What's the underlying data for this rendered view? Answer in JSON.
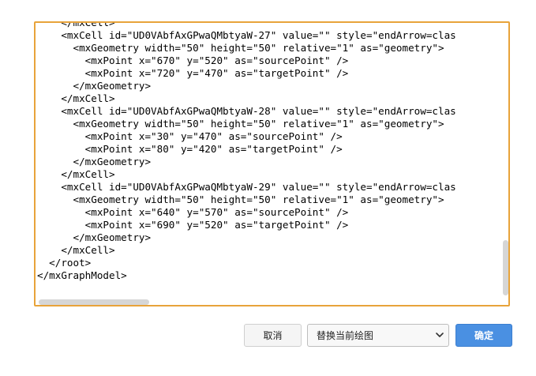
{
  "editor": {
    "lines": [
      "    </mxCell>",
      "    <mxCell id=\"UD0VAbfAxGPwaQMbtyaW-27\" value=\"\" style=\"endArrow=clas",
      "      <mxGeometry width=\"50\" height=\"50\" relative=\"1\" as=\"geometry\">",
      "        <mxPoint x=\"670\" y=\"520\" as=\"sourcePoint\" />",
      "        <mxPoint x=\"720\" y=\"470\" as=\"targetPoint\" />",
      "      </mxGeometry>",
      "    </mxCell>",
      "    <mxCell id=\"UD0VAbfAxGPwaQMbtyaW-28\" value=\"\" style=\"endArrow=clas",
      "      <mxGeometry width=\"50\" height=\"50\" relative=\"1\" as=\"geometry\">",
      "        <mxPoint x=\"30\" y=\"470\" as=\"sourcePoint\" />",
      "        <mxPoint x=\"80\" y=\"420\" as=\"targetPoint\" />",
      "      </mxGeometry>",
      "    </mxCell>",
      "    <mxCell id=\"UD0VAbfAxGPwaQMbtyaW-29\" value=\"\" style=\"endArrow=clas",
      "      <mxGeometry width=\"50\" height=\"50\" relative=\"1\" as=\"geometry\">",
      "        <mxPoint x=\"640\" y=\"570\" as=\"sourcePoint\" />",
      "        <mxPoint x=\"690\" y=\"520\" as=\"targetPoint\" />",
      "      </mxGeometry>",
      "    </mxCell>",
      "  </root>",
      "</mxGraphModel>"
    ]
  },
  "footer": {
    "cancel_label": "取消",
    "mode_select_value": "替换当前绘图",
    "ok_label": "确定"
  },
  "colors": {
    "editor_border": "#e8a33a",
    "ok_button": "#4a90e2"
  }
}
